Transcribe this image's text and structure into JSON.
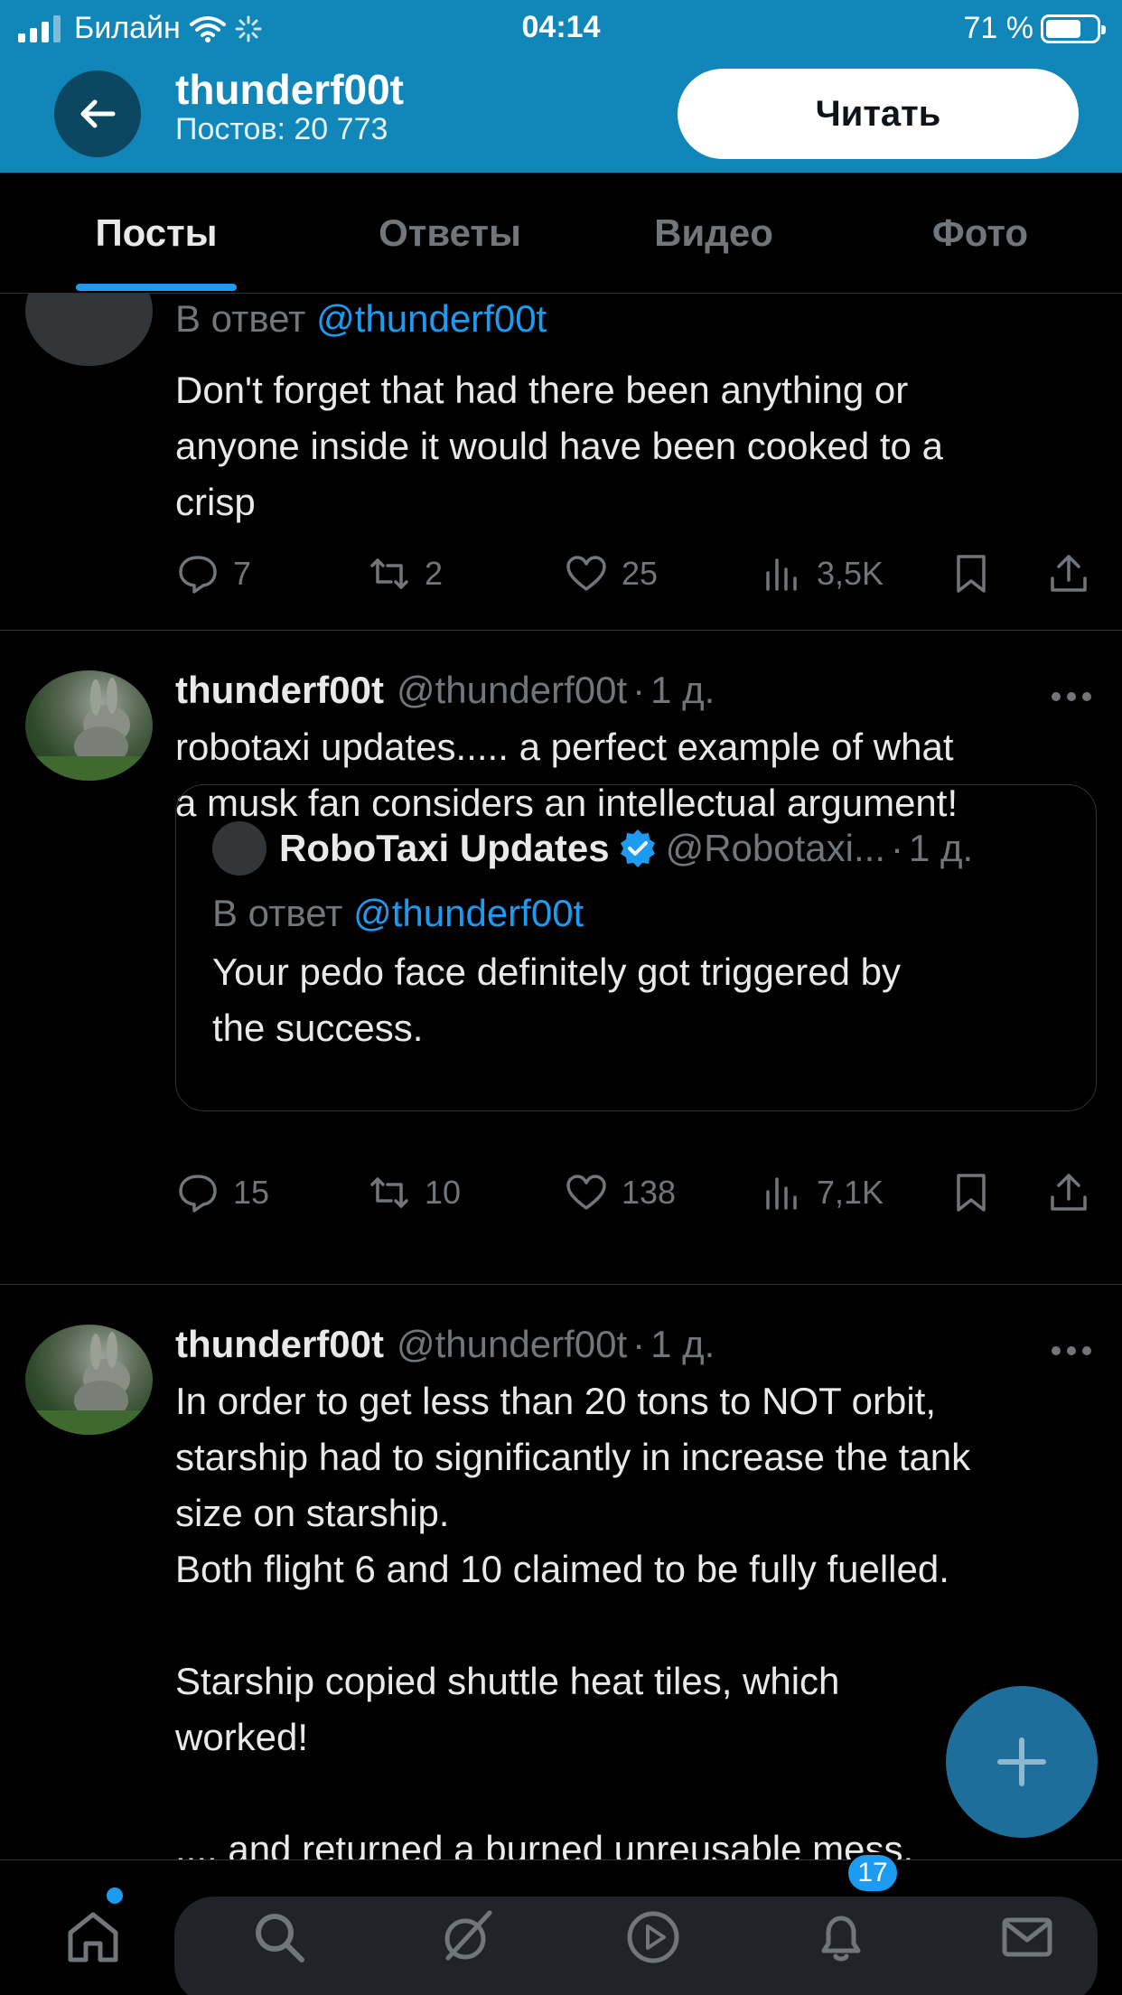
{
  "status_bar": {
    "carrier": "Билайн",
    "time": "04:14",
    "battery": "71 %",
    "battery_level": 0.71
  },
  "header": {
    "name": "thunderf00t",
    "posts_count": "Постов: 20 773",
    "follow_label": "Читать"
  },
  "tabs": [
    {
      "label": "Посты",
      "active": true
    },
    {
      "label": "Ответы",
      "active": false
    },
    {
      "label": "Видео",
      "active": false
    },
    {
      "label": "Фото",
      "active": false
    }
  ],
  "posts": [
    {
      "reply_prefix": "В ответ",
      "reply_handle": "@thunderf00t",
      "text": "Don't forget that had there been anything or\nanyone inside it would have been cooked to a\ncrisp",
      "stats": {
        "replies": "7",
        "reposts": "2",
        "likes": "25",
        "views": "3,5K"
      }
    },
    {
      "author": "thunderf00t",
      "handle": "@thunderf00t",
      "sep": "·",
      "time": "1 д.",
      "text": "robotaxi updates..... a perfect example of what\na musk fan considers an intellectual argument!",
      "quote": {
        "author": "RoboTaxi Updates",
        "handle": "@Robotaxi...",
        "sep": "·",
        "time": "1 д.",
        "reply_prefix": "В ответ",
        "reply_handle": "@thunderf00t",
        "text": "Your pedo face definitely got triggered by\nthe success."
      },
      "stats": {
        "replies": "15",
        "reposts": "10",
        "likes": "138",
        "views": "7,1K"
      }
    },
    {
      "author": "thunderf00t",
      "handle": "@thunderf00t",
      "sep": "·",
      "time": "1 д.",
      "text": "In order to get less than 20 tons to NOT orbit,\nstarship had to significantly in increase the tank\nsize on starship.\nBoth flight 6 and 10 claimed to be fully fuelled.\n\nStarship copied shuttle heat tiles, which\nworked!\n\n.... and returned a burned unreusable mess."
    }
  ],
  "nav": {
    "notifications_badge": "17"
  },
  "colors": {
    "header_bg": "#1186b8",
    "accent": "#1d9bf0",
    "muted": "#71767b"
  }
}
